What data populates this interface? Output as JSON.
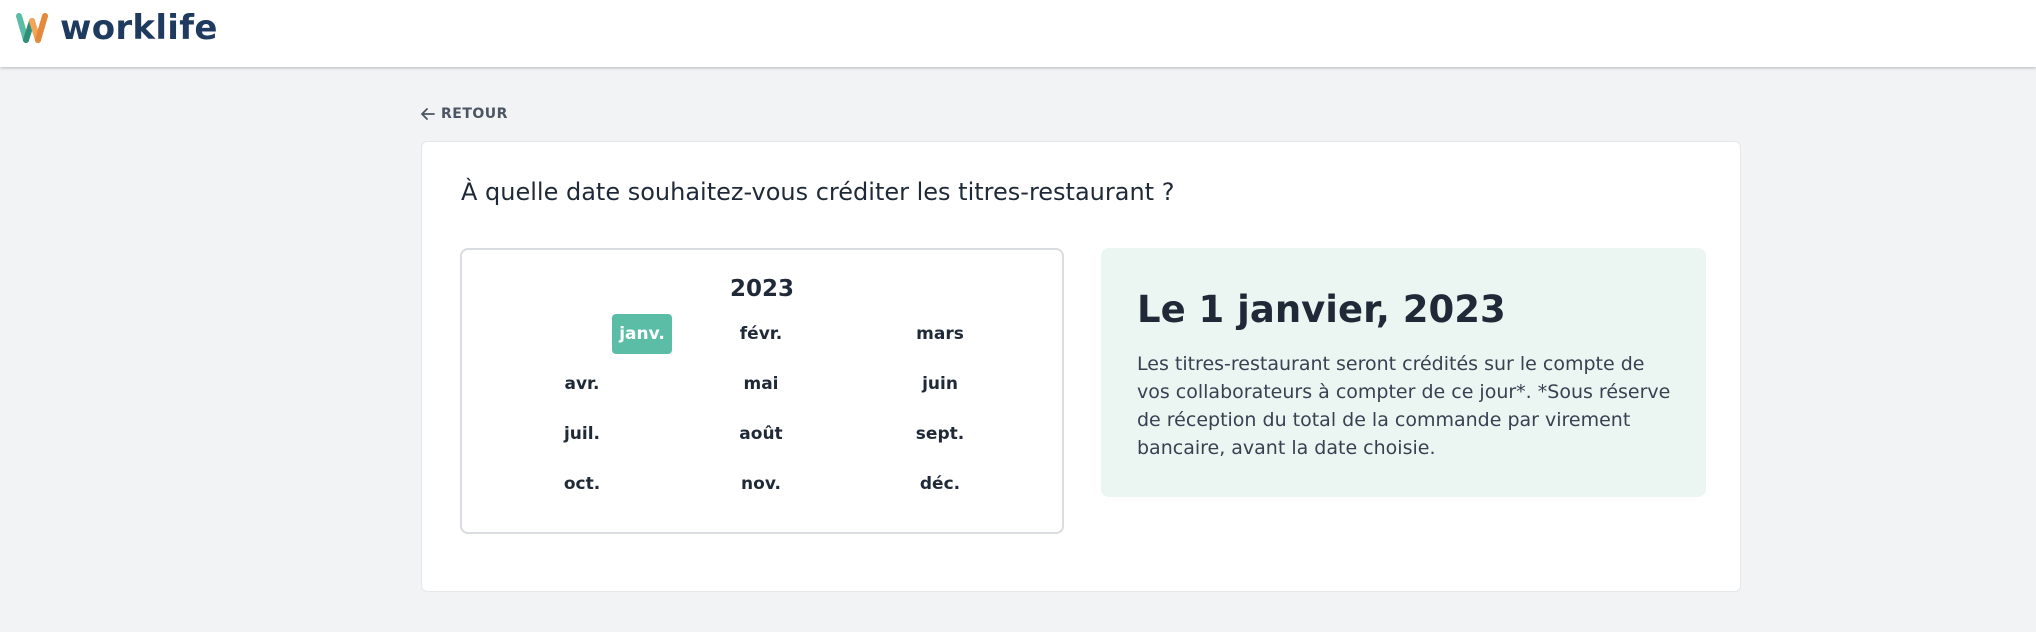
{
  "header": {
    "brand": "worklife",
    "logo_icon": "worklife-w-logo",
    "colors": {
      "logo_teal": "#5cbda6",
      "logo_orange": "#f2a65a",
      "brand_navy": "#1e3a5f"
    }
  },
  "nav": {
    "back_label": "RETOUR",
    "back_icon": "arrow-left-icon"
  },
  "main": {
    "question": "À quelle date souhaitez-vous créditer les titres-restaurant ?",
    "calendar": {
      "year": "2023",
      "selected_month": "janv.",
      "months": [
        "janv.",
        "févr.",
        "mars",
        "avr.",
        "mai",
        "juin",
        "juil.",
        "août",
        "sept.",
        "oct.",
        "nov.",
        "déc."
      ],
      "accent_color": "#5cbda6"
    },
    "info": {
      "date": "Le 1 janvier, 2023",
      "text": "Les titres-restaurant seront crédités sur le compte de vos collaborateurs à compter de ce jour*. *Sous réserve de réception du total de la commande par virement bancaire, avant la date choisie.",
      "background": "#ebf6f2"
    }
  }
}
